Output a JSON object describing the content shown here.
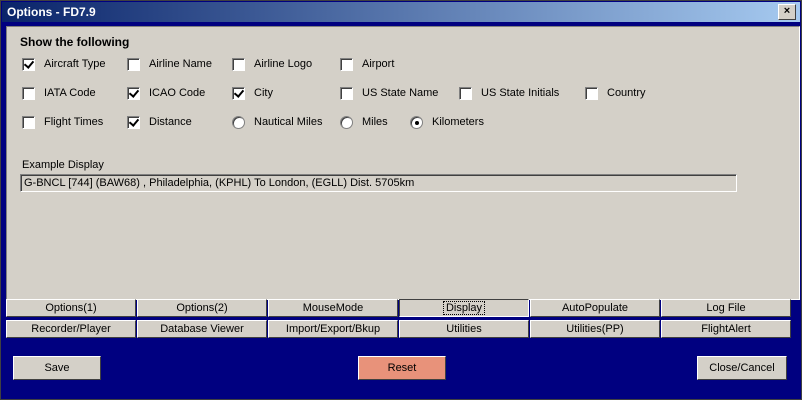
{
  "window": {
    "title": "Options - FD7.9",
    "close_glyph": "×"
  },
  "panel": {
    "heading": "Show the following",
    "rows": [
      [
        {
          "label": "Aircraft Type",
          "type": "checkbox",
          "checked": true
        },
        {
          "label": "Airline Name",
          "type": "checkbox",
          "checked": false
        },
        {
          "label": "Airline Logo",
          "type": "checkbox",
          "checked": false
        },
        {
          "label": "Airport",
          "type": "checkbox",
          "checked": false
        }
      ],
      [
        {
          "label": "IATA Code",
          "type": "checkbox",
          "checked": false
        },
        {
          "label": "ICAO Code",
          "type": "checkbox",
          "checked": true
        },
        {
          "label": "City",
          "type": "checkbox",
          "checked": true
        },
        {
          "label": "US State Name",
          "type": "checkbox",
          "checked": false
        },
        {
          "label": "US State Initials",
          "type": "checkbox",
          "checked": false
        },
        {
          "label": "Country",
          "type": "checkbox",
          "checked": false
        }
      ],
      [
        {
          "label": "Flight Times",
          "type": "checkbox",
          "checked": false
        },
        {
          "label": "Distance",
          "type": "checkbox",
          "checked": true
        },
        {
          "label": "Nautical Miles",
          "type": "radio",
          "checked": false
        },
        {
          "label": "Miles",
          "type": "radio",
          "checked": false
        },
        {
          "label": "Kilometers",
          "type": "radio",
          "checked": true
        }
      ]
    ],
    "example_label": "Example Display",
    "example_value": "G-BNCL [744] (BAW68) , Philadelphia, (KPHL) To London, (EGLL) Dist. 5705km"
  },
  "tabs": {
    "row1": [
      "Options(1)",
      "Options(2)",
      "MouseMode",
      "Display",
      "AutoPopulate",
      "Log File"
    ],
    "row2": [
      "Recorder/Player",
      "Database Viewer",
      "Import/Export/Bkup",
      "Utilities",
      "Utilities(PP)",
      "FlightAlert"
    ],
    "active": "Display"
  },
  "buttons": {
    "save": "Save",
    "reset": "Reset",
    "close": "Close/Cancel"
  },
  "colors": {
    "window_bg": "#000080",
    "panel_bg": "#d4d0c8",
    "reset_bg": "#e8927a"
  }
}
